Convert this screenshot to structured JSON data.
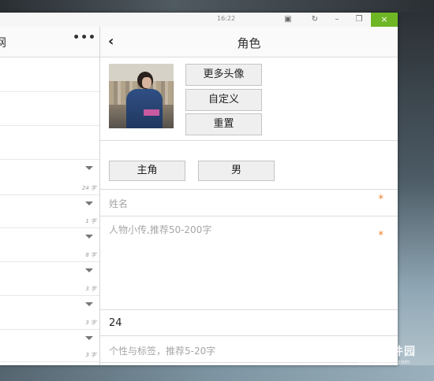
{
  "titlebar": {
    "clock": "16:22",
    "buttons": {
      "screenshot_icon": "▣",
      "refresh_icon": "↻",
      "minimize_icon": "–",
      "restore_icon": "❐",
      "close_icon": "×"
    }
  },
  "left_pane": {
    "title": "网",
    "more_icon": "•••",
    "rows": [
      {
        "count": ""
      },
      {
        "count": ""
      },
      {
        "count": ""
      },
      {
        "count": "24 字"
      },
      {
        "count": "1 字"
      },
      {
        "count": "8 字"
      },
      {
        "count": "3 字"
      },
      {
        "count": "3 字"
      },
      {
        "count": "3 字"
      }
    ]
  },
  "role_panel": {
    "back_icon": "‹",
    "title": "角色",
    "avatar_buttons": {
      "more_avatars": "更多头像",
      "custom": "自定义",
      "reset": "重置"
    },
    "role_type": "主角",
    "gender": "男",
    "fields": {
      "name_placeholder": "姓名",
      "bio_placeholder": "人物小传,推荐50-200字",
      "age_value": "24",
      "tags_placeholder": "个性与标签，推荐5-20字"
    },
    "required_mark": "*"
  },
  "watermark": {
    "brand": "当下软件园",
    "url": "www.downxia.com"
  }
}
